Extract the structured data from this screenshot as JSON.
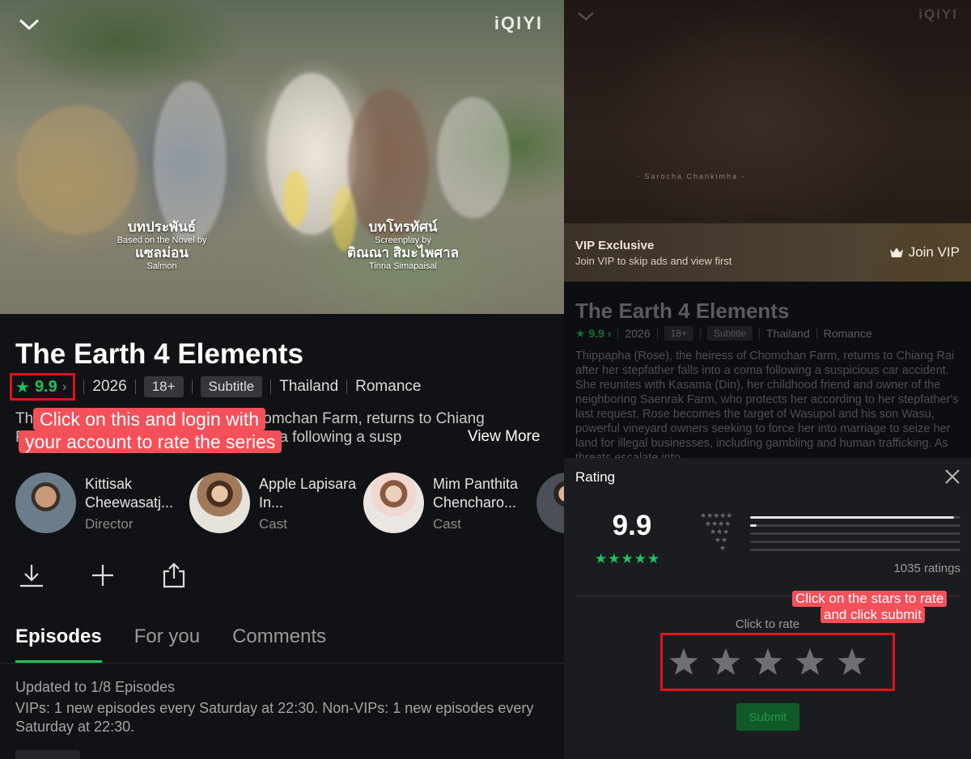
{
  "left": {
    "video": {
      "logo": "iQIYI",
      "credits": [
        {
          "th": "บทประพันธ์",
          "en_label": "Based on the Novel by",
          "th_name": "แซลม่อน",
          "en_name": "Salmon"
        },
        {
          "th": "บทโทรทัศน์",
          "en_label": "Screenplay by",
          "th_name": "ติณณา สิมะไพศาล",
          "en_name": "Tinna Simapaisal"
        }
      ]
    },
    "title": "The Earth 4 Elements",
    "rating": "9.9",
    "year": "2026",
    "age": "18+",
    "subtitle_tag": "Subtitle",
    "country": "Thailand",
    "genre": "Romance",
    "description_line1": "Thippapha (Rose), the heiress of Chomchan Farm, returns to Chiang",
    "description_line2": "Rai after her stepfather falls into a coma following a susp",
    "view_more": "View More",
    "callout_line1": "Click on this and login with",
    "callout_line2": "your account to rate the series",
    "cast": [
      {
        "name": "Kittisak Cheewasatj...",
        "role": "Director"
      },
      {
        "name": "Apple Lapisara In...",
        "role": "Cast"
      },
      {
        "name": "Mim Panthita Chencharo...",
        "role": "Cast"
      }
    ],
    "tabs": [
      "Episodes",
      "For you",
      "Comments"
    ],
    "updated": "Updated to 1/8 Episodes",
    "schedule": "VIPs: 1 new episodes every Saturday at 22:30. Non-VIPs: 1 new episodes every Saturday at 22:30."
  },
  "right": {
    "logo": "iQIYI",
    "video_credit": "- Sarocha Chankimha -",
    "vip_title": "VIP Exclusive",
    "vip_sub": "Join VIP to skip ads and view first",
    "join_vip": "Join VIP",
    "title": "The Earth 4 Elements",
    "rating": "9.9",
    "year": "2026",
    "age": "18+",
    "subtitle_tag": "Subtitle",
    "country": "Thailand",
    "genre": "Romance",
    "description": "Thippapha (Rose), the heiress of Chomchan Farm, returns to Chiang Rai after her stepfather falls into a coma following a suspicious car accident. She reunites with Kasama (Din), her childhood friend and owner of the neighboring Saenrak Farm, who protects her according to her stepfather's last request. Rose becomes the target of Wasupol and his son Wasu, powerful vineyard owners seeking to force her into marriage to seize her land for illegal businesses, including gambling and human trafficking. As threats escalate into",
    "sheet": {
      "title": "Rating",
      "score": "9.9",
      "score_stars": "★★★★★",
      "distribution": [
        {
          "stars": "★★★★★",
          "fraction": 0.97
        },
        {
          "stars": "★★★★",
          "fraction": 0.03
        },
        {
          "stars": "★★★",
          "fraction": 0.0
        },
        {
          "stars": "★★",
          "fraction": 0.0
        },
        {
          "stars": "★",
          "fraction": 0.0
        }
      ],
      "count": "1035 ratings",
      "click_to_rate": "Click to rate",
      "submit": "Submit",
      "callout_line1": "Click on the stars to rate",
      "callout_line2": "and click submit"
    }
  },
  "colors": {
    "accent_green": "#1ec35a",
    "annotation_red": "#e0131b",
    "callout_pink": "#f4505a"
  }
}
